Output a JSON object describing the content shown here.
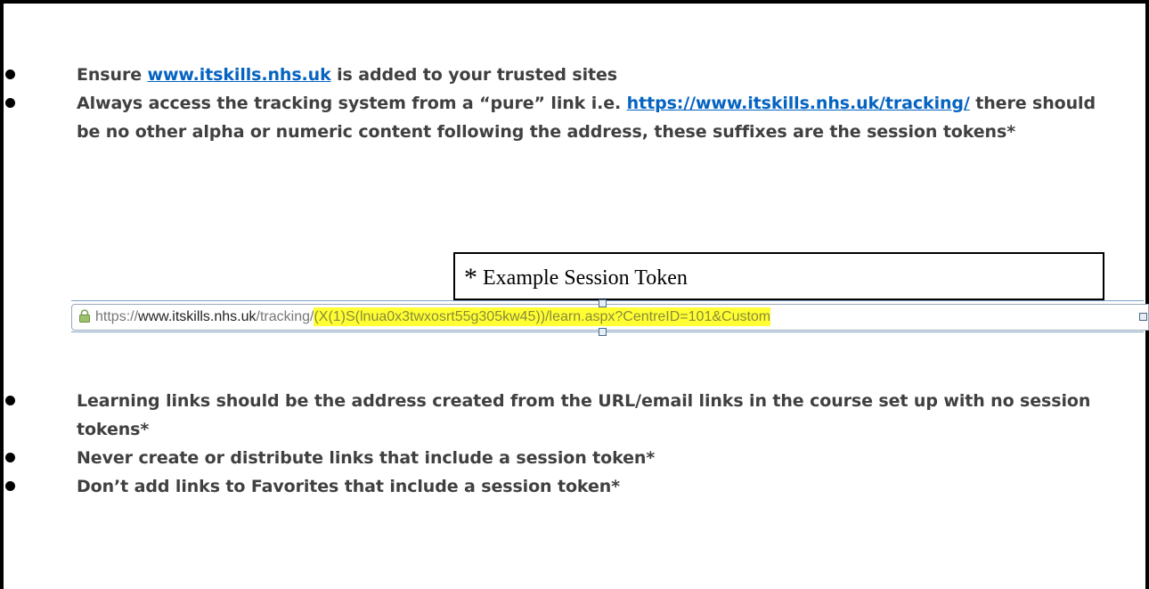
{
  "bullets_top": [
    {
      "segments": [
        {
          "text": "Ensure ",
          "type": "text"
        },
        {
          "text": "www.itskills.nhs.uk",
          "type": "link"
        },
        {
          "text": " is added to your trusted sites",
          "type": "text"
        }
      ]
    },
    {
      "segments": [
        {
          "text": "Always access the tracking system from a “pure” link i.e. ",
          "type": "text"
        },
        {
          "text": "https://www.itskills.nhs.uk/tracking/",
          "type": "link"
        },
        {
          "text": " there should be no other alpha or numeric content following the address, these suffixes are the session tokens*",
          "type": "text"
        }
      ]
    }
  ],
  "callout": {
    "star": "*",
    "label": "Example Session Token"
  },
  "address_bar": {
    "scheme": "https://",
    "host": "www.itskills.nhs.uk",
    "path": "/tracking/",
    "token": "(X(1)S(lnua0x3twxosrt55g305kw45))/learn.aspx?CentreID=101&Custom",
    "lock_icon": "lock-icon"
  },
  "bullets_bottom": [
    {
      "text": "Learning links should be the address created from the URL/email links in the course set up with no session tokens*"
    },
    {
      "text": "Never create or distribute links that include a session token*"
    },
    {
      "text": "Don’t add links to Favorites that include a session token*"
    }
  ],
  "colors": {
    "link": "#0563c1",
    "body_text": "#404040",
    "highlight": "#ffff33"
  }
}
